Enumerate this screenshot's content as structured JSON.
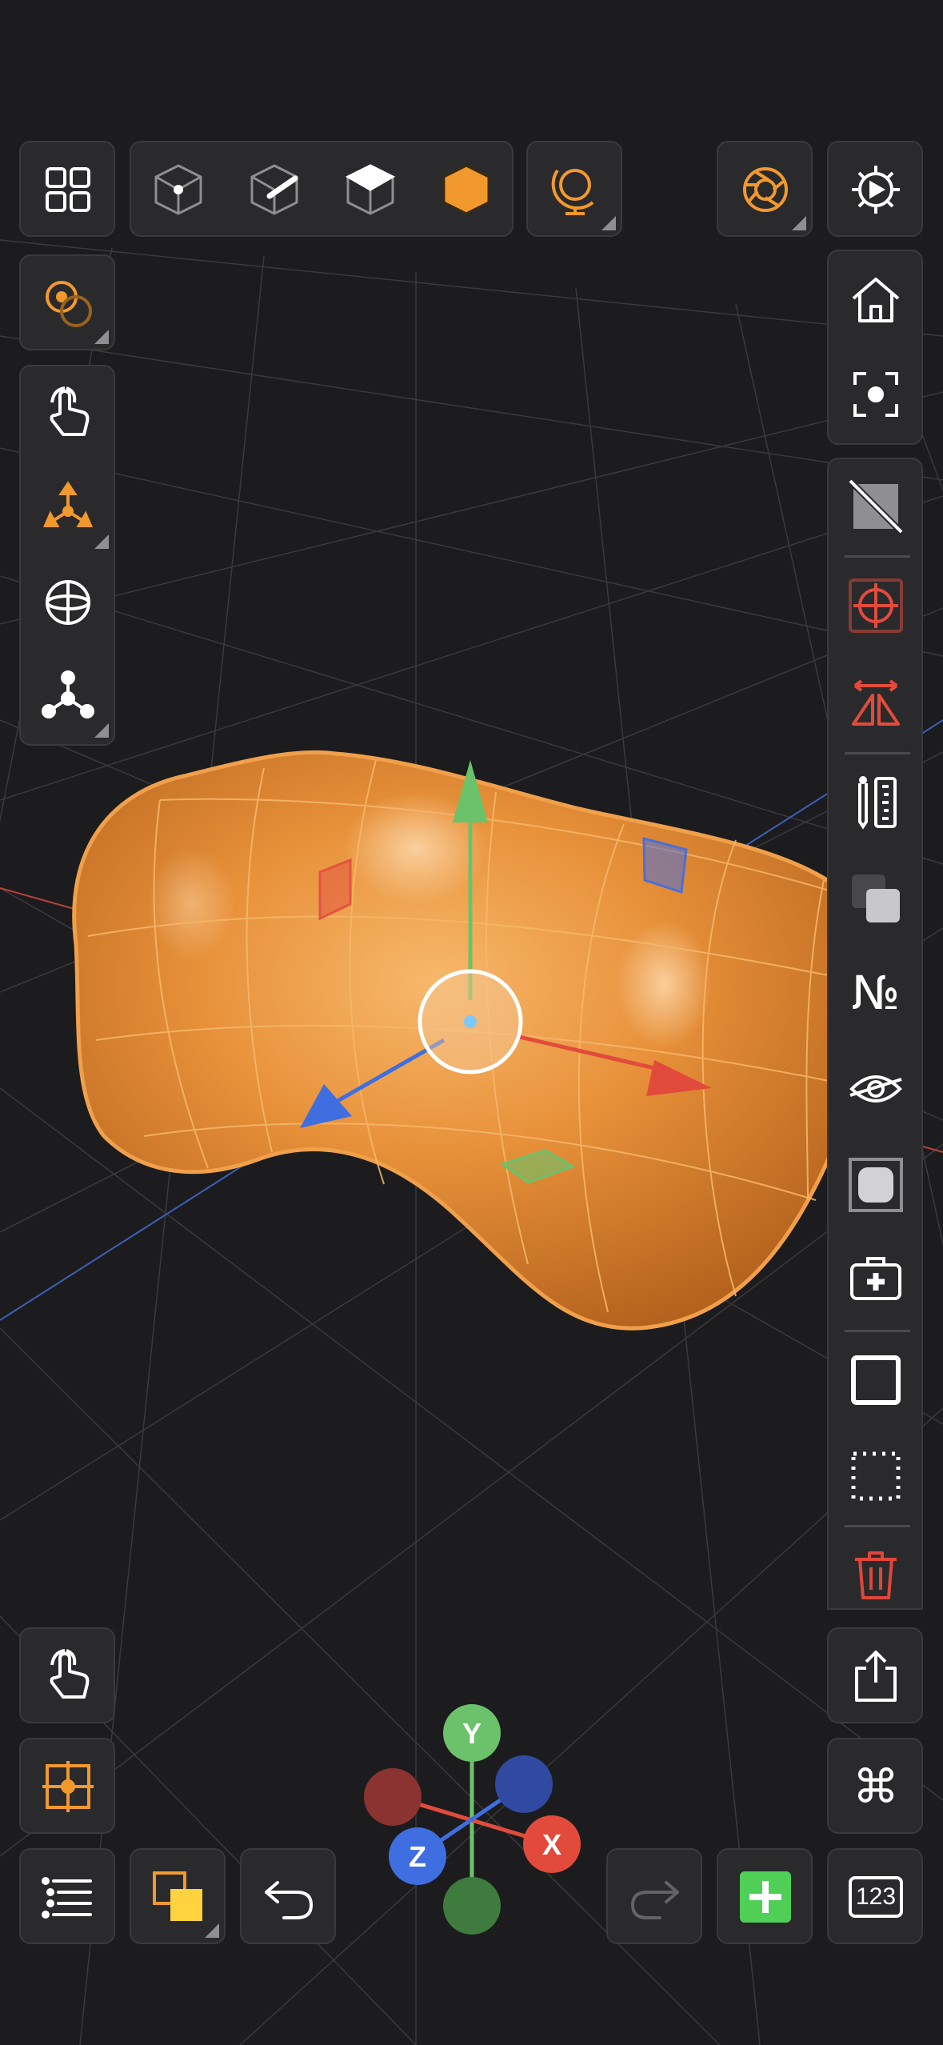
{
  "colors": {
    "background": "#1c1c1e",
    "panel": "#2a2a2c",
    "accent_orange": "#f2992e",
    "axis_x": "#e24b3b",
    "axis_y": "#6cc26a",
    "axis_z": "#3f6ee0",
    "add_green": "#4fcf56",
    "delete_red": "#e0463a"
  },
  "top_toolbar": {
    "icons": [
      "grid-menu-icon",
      "vertex-mode-icon",
      "edge-mode-icon",
      "face-mode-icon",
      "object-mode-icon",
      "environment-icon",
      "camera-aperture-icon",
      "settings-icon"
    ]
  },
  "left_toolbar": {
    "icons": [
      "pivot-icon",
      "touch-icon",
      "move-axes-icon",
      "sphere-icon",
      "vertex-graph-icon"
    ]
  },
  "right_toolbar": {
    "icons": [
      "home-icon",
      "focus-icon",
      "hide-background-icon",
      "snap-target-icon",
      "mirror-icon",
      "ruler-icon",
      "duplicate-icon",
      "numbering-icon",
      "visibility-icon",
      "rounded-square-icon",
      "first-aid-icon",
      "square-icon",
      "dotted-select-icon",
      "trash-icon"
    ],
    "numbering_label": "№"
  },
  "bottom_left": {
    "icons": [
      "touch-icon",
      "center-target-icon",
      "list-icon",
      "layers-icon",
      "undo-icon"
    ]
  },
  "bottom_right": {
    "icons": [
      "share-icon",
      "command-icon",
      "redo-icon",
      "add-icon",
      "keypad-icon"
    ],
    "keypad_label": "123",
    "command_label": "⌘"
  },
  "orientation_gizmo": {
    "y_label": "Y",
    "x_label": "X",
    "z_label": "Z"
  }
}
